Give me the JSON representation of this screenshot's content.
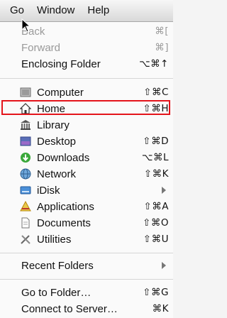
{
  "menubar": {
    "items": [
      "Go",
      "Window",
      "Help"
    ]
  },
  "menu": {
    "items": [
      {
        "label": "Back",
        "shortcut": "⌘[",
        "disabled": true
      },
      {
        "label": "Forward",
        "shortcut": "⌘]",
        "disabled": true
      },
      {
        "label": "Enclosing Folder",
        "shortcut": "⌥⌘↑"
      },
      {
        "label": "Computer",
        "shortcut": "⇧⌘C",
        "icon": "computer-icon"
      },
      {
        "label": "Home",
        "shortcut": "⇧⌘H",
        "icon": "home-icon"
      },
      {
        "label": "Library",
        "icon": "library-icon"
      },
      {
        "label": "Desktop",
        "shortcut": "⇧⌘D",
        "icon": "desktop-icon"
      },
      {
        "label": "Downloads",
        "shortcut": "⌥⌘L",
        "icon": "downloads-icon"
      },
      {
        "label": "Network",
        "shortcut": "⇧⌘K",
        "icon": "network-icon"
      },
      {
        "label": "iDisk",
        "icon": "idisk-icon",
        "submenu": true
      },
      {
        "label": "Applications",
        "shortcut": "⇧⌘A",
        "icon": "applications-icon"
      },
      {
        "label": "Documents",
        "shortcut": "⇧⌘O",
        "icon": "documents-icon"
      },
      {
        "label": "Utilities",
        "shortcut": "⇧⌘U",
        "icon": "utilities-icon"
      },
      {
        "label": "Recent Folders",
        "submenu": true
      },
      {
        "label": "Go to Folder…",
        "shortcut": "⇧⌘G"
      },
      {
        "label": "Connect to Server…",
        "shortcut": "⌘K"
      }
    ]
  },
  "colors": {
    "highlight_border": "#e4141b"
  }
}
